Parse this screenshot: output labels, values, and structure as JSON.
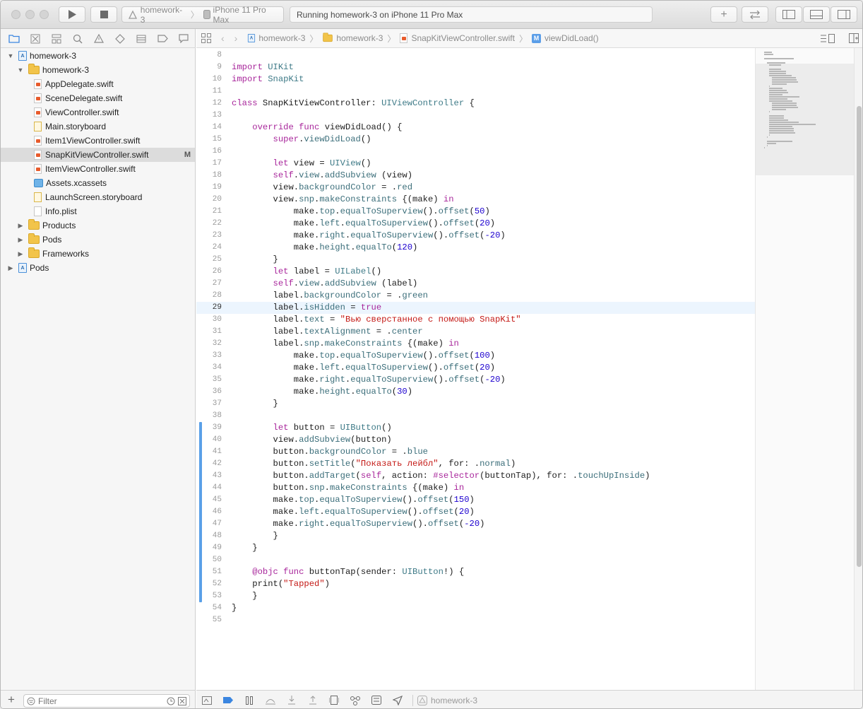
{
  "toolbar": {
    "scheme": "homework-3",
    "destination": "iPhone 11 Pro Max",
    "activity": "Running homework-3 on iPhone 11 Pro Max"
  },
  "navigator": {
    "tree": [
      {
        "label": "homework-3",
        "kind": "project",
        "depth": 0,
        "disclosure": "open"
      },
      {
        "label": "homework-3",
        "kind": "folder",
        "depth": 1,
        "disclosure": "open"
      },
      {
        "label": "AppDelegate.swift",
        "kind": "swift",
        "depth": 2
      },
      {
        "label": "SceneDelegate.swift",
        "kind": "swift",
        "depth": 2
      },
      {
        "label": "ViewController.swift",
        "kind": "swift",
        "depth": 2
      },
      {
        "label": "Main.storyboard",
        "kind": "storyboard",
        "depth": 2
      },
      {
        "label": "Item1ViewController.swift",
        "kind": "swift",
        "depth": 2
      },
      {
        "label": "SnapKitViewController.swift",
        "kind": "swift",
        "depth": 2,
        "selected": true,
        "badge": "M"
      },
      {
        "label": "ItemViewController.swift",
        "kind": "swift",
        "depth": 2
      },
      {
        "label": "Assets.xcassets",
        "kind": "assets",
        "depth": 2
      },
      {
        "label": "LaunchScreen.storyboard",
        "kind": "storyboard",
        "depth": 2
      },
      {
        "label": "Info.plist",
        "kind": "plist",
        "depth": 2
      },
      {
        "label": "Products",
        "kind": "folder",
        "depth": 1,
        "disclosure": "closed"
      },
      {
        "label": "Pods",
        "kind": "folder",
        "depth": 1,
        "disclosure": "closed"
      },
      {
        "label": "Frameworks",
        "kind": "folder",
        "depth": 1,
        "disclosure": "closed"
      },
      {
        "label": "Pods",
        "kind": "project",
        "depth": 0,
        "disclosure": "closed"
      }
    ],
    "filter_placeholder": "Filter"
  },
  "jumpbar": {
    "crumbs": [
      "homework-3",
      "homework-3",
      "SnapKitViewController.swift",
      "viewDidLoad()"
    ],
    "method_badge": "M"
  },
  "editor": {
    "current_line": 29,
    "lines": [
      {
        "n": "8",
        "code": ""
      },
      {
        "n": "9",
        "code": "import UIKit"
      },
      {
        "n": "10",
        "code": "import SnapKit"
      },
      {
        "n": "11",
        "code": ""
      },
      {
        "n": "12",
        "code": "class SnapKitViewController: UIViewController {"
      },
      {
        "n": "13",
        "code": ""
      },
      {
        "n": "14",
        "code": "    override func viewDidLoad() {"
      },
      {
        "n": "15",
        "code": "        super.viewDidLoad()"
      },
      {
        "n": "16",
        "code": ""
      },
      {
        "n": "17",
        "code": "        let view = UIView()"
      },
      {
        "n": "18",
        "code": "        self.view.addSubview (view)"
      },
      {
        "n": "19",
        "code": "        view.backgroundColor = .red"
      },
      {
        "n": "20",
        "code": "        view.snp.makeConstraints {(make) in"
      },
      {
        "n": "21",
        "code": "            make.top.equalToSuperview().offset(50)"
      },
      {
        "n": "22",
        "code": "            make.left.equalToSuperview().offset(20)"
      },
      {
        "n": "23",
        "code": "            make.right.equalToSuperview().offset(-20)"
      },
      {
        "n": "24",
        "code": "            make.height.equalTo(120)"
      },
      {
        "n": "25",
        "code": "        }"
      },
      {
        "n": "26",
        "code": "        let label = UILabel()"
      },
      {
        "n": "27",
        "code": "        self.view.addSubview (label)"
      },
      {
        "n": "28",
        "code": "        label.backgroundColor = .green"
      },
      {
        "n": "29",
        "code": "        label.isHidden = true"
      },
      {
        "n": "30",
        "code": "        label.text = \"Вью сверстанное с помощью SnapKit\""
      },
      {
        "n": "31",
        "code": "        label.textAlignment = .center"
      },
      {
        "n": "32",
        "code": "        label.snp.makeConstraints {(make) in"
      },
      {
        "n": "33",
        "code": "            make.top.equalToSuperview().offset(100)"
      },
      {
        "n": "34",
        "code": "            make.left.equalToSuperview().offset(20)"
      },
      {
        "n": "35",
        "code": "            make.right.equalToSuperview().offset(-20)"
      },
      {
        "n": "36",
        "code": "            make.height.equalTo(30)"
      },
      {
        "n": "37",
        "code": "        }"
      },
      {
        "n": "38",
        "code": ""
      },
      {
        "n": "39",
        "code": "        let button = UIButton()"
      },
      {
        "n": "40",
        "code": "        view.addSubview(button)"
      },
      {
        "n": "41",
        "code": "        button.backgroundColor = .blue"
      },
      {
        "n": "42",
        "code": "        button.setTitle(\"Показать лейбл\", for: .normal)"
      },
      {
        "n": "43",
        "code": "        button.addTarget(self, action: #selector(buttonTap), for: .touchUpInside)"
      },
      {
        "n": "44",
        "code": "        button.snp.makeConstraints {(make) in"
      },
      {
        "n": "45",
        "code": "        make.top.equalToSuperview().offset(150)"
      },
      {
        "n": "46",
        "code": "        make.left.equalToSuperview().offset(20)"
      },
      {
        "n": "47",
        "code": "        make.right.equalToSuperview().offset(-20)"
      },
      {
        "n": "48",
        "code": "        }"
      },
      {
        "n": "49",
        "code": "    }"
      },
      {
        "n": "50",
        "code": ""
      },
      {
        "n": "51",
        "code": "    @objc func buttonTap(sender: UIButton!) {"
      },
      {
        "n": "52",
        "code": "    print(\"Tapped\")"
      },
      {
        "n": "53",
        "code": "    }"
      },
      {
        "n": "54",
        "code": "}"
      },
      {
        "n": "55",
        "code": ""
      }
    ]
  },
  "debugbar": {
    "target": "homework-3"
  },
  "colors": {
    "keyword": "#a8269b",
    "type": "#3e7a87",
    "string": "#c41a16",
    "number": "#1c00cf",
    "change_bar": "#5aa0e8",
    "current_line": "#ecf5fe",
    "selection": "#dcdcdc"
  }
}
